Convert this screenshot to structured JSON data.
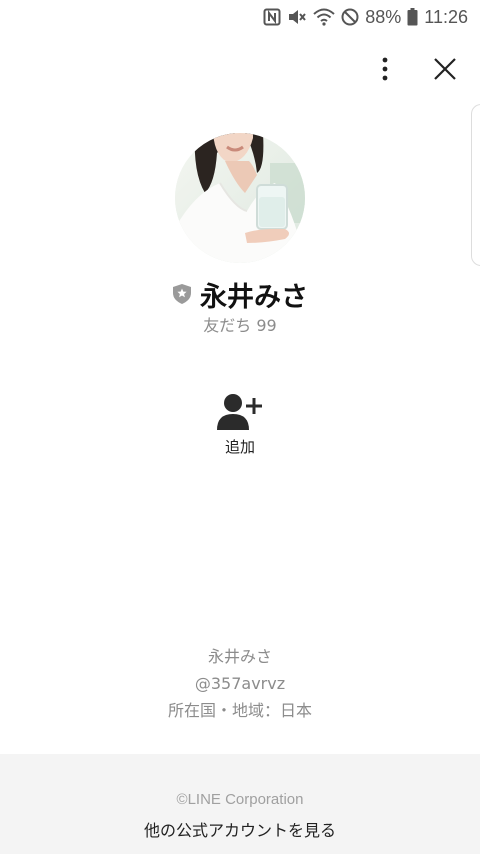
{
  "status_bar": {
    "battery_percent": "88%",
    "time": "11:26",
    "icons": [
      "nfc-icon",
      "mute-icon",
      "wifi-icon",
      "dnd-icon",
      "battery-icon"
    ]
  },
  "profile": {
    "name": "永井みさ",
    "friends": "友だち 99",
    "badge_icon": "shield-star-icon"
  },
  "actions": {
    "add_label": "追加",
    "add_icon": "add-friend-icon"
  },
  "info": {
    "display_name": "永井みさ",
    "line_id": "@357avrvz",
    "region": "所在国・地域：日本"
  },
  "footer": {
    "copyright": "©LINE Corporation",
    "official_accounts_link": "他の公式アカウントを見る"
  },
  "colors": {
    "badge_gray": "#9a9a9a",
    "muted_text": "#8c8c8c",
    "footer_bg": "#f4f4f4"
  }
}
